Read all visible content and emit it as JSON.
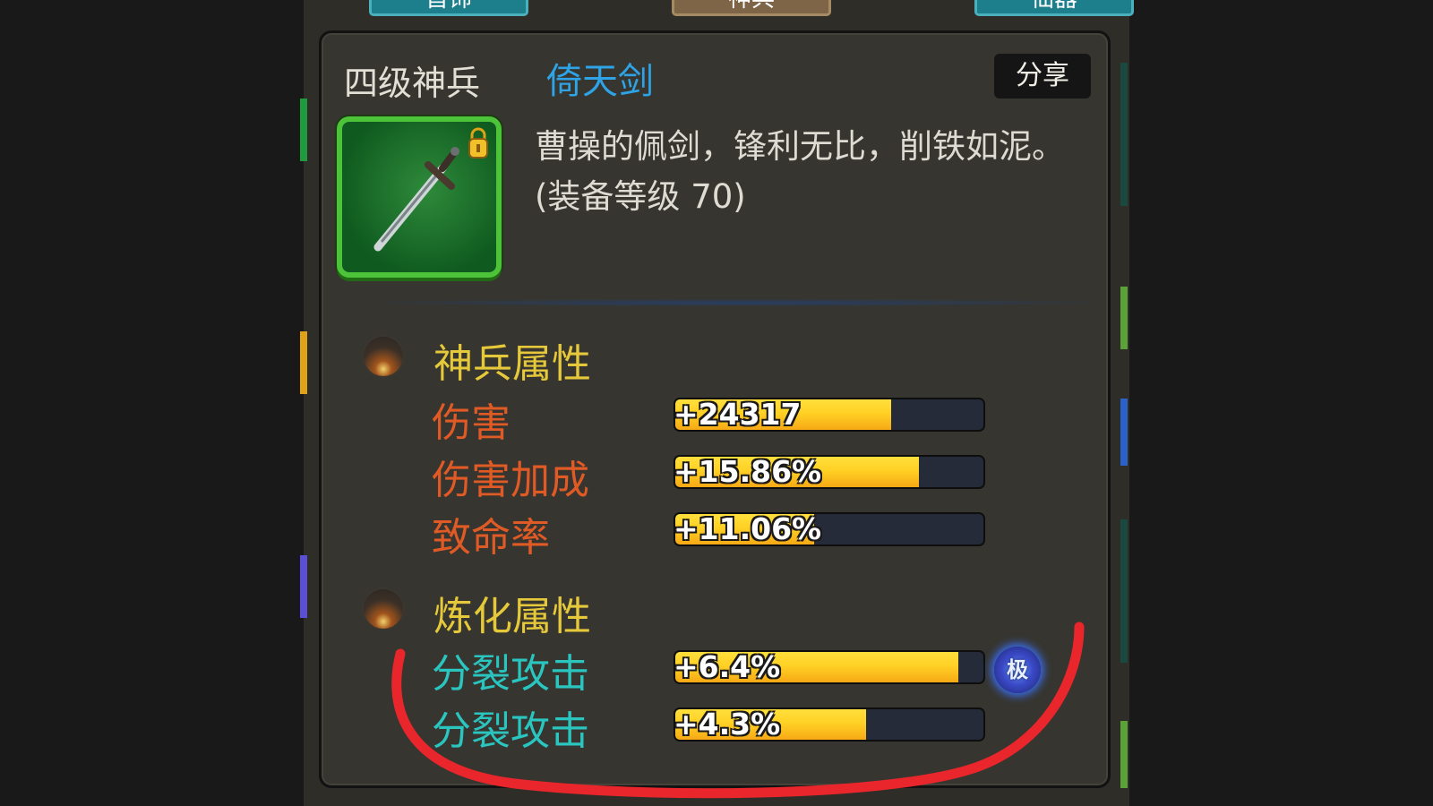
{
  "top_tabs": [
    {
      "label": "首饰"
    },
    {
      "label": "神兵"
    },
    {
      "label": "仙器"
    }
  ],
  "item": {
    "rank": "四级神兵",
    "name": "倚天剑",
    "share_label": "分享",
    "description": "曹操的佩剑，锋利无比，削铁如泥。(装备等级 70)"
  },
  "sections": {
    "shenbing": {
      "title": "神兵属性",
      "attributes": [
        {
          "label": "伤害",
          "value": "+24317",
          "fill_percent": 70
        },
        {
          "label": "伤害加成",
          "value": "+15.86%",
          "fill_percent": 79
        },
        {
          "label": "致命率",
          "value": "+11.06%",
          "fill_percent": 45
        }
      ]
    },
    "refine": {
      "title": "炼化属性",
      "attributes": [
        {
          "label": "分裂攻击",
          "value": "+6.4%",
          "fill_percent": 92,
          "badge": "极"
        },
        {
          "label": "分裂攻击",
          "value": "+4.3%",
          "fill_percent": 62
        }
      ]
    }
  },
  "colors": {
    "item_name": "#2ea3e6",
    "section_title": "#e5c93a",
    "attr_orange": "#e05a26",
    "attr_cyan": "#2bc5c0",
    "bar_fill": "#ffd125",
    "icon_border": "#4cc338",
    "annotation": "#e8262b"
  },
  "icons": {
    "item": "sword-icon",
    "lock": "lock-icon",
    "orb": "orb-icon",
    "max_badge": "max-level-badge"
  }
}
